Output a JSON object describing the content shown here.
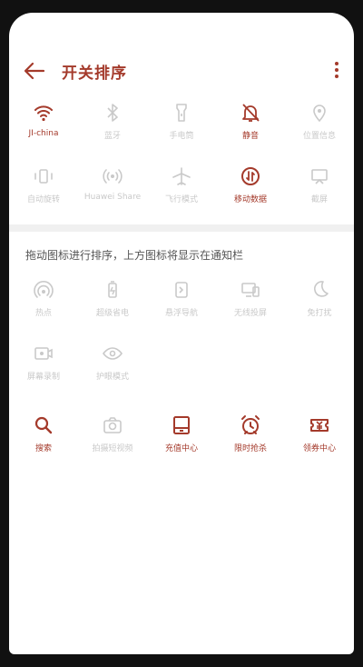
{
  "header": {
    "title": "开关排序"
  },
  "hint": "拖动图标进行排序，上方图标将显示在通知栏",
  "colors": {
    "accent": "#a43a2b",
    "inactive": "#c9c9c9"
  },
  "top_items": [
    {
      "label": "JI-china",
      "icon": "wifi-icon",
      "active": true
    },
    {
      "label": "蓝牙",
      "icon": "bluetooth-icon",
      "active": false
    },
    {
      "label": "手电筒",
      "icon": "flashlight-icon",
      "active": false
    },
    {
      "label": "静音",
      "icon": "bell-off-icon",
      "active": true
    },
    {
      "label": "位置信息",
      "icon": "location-icon",
      "active": false
    },
    {
      "label": "自动旋转",
      "icon": "rotate-icon",
      "active": false
    },
    {
      "label": "Huawei Share",
      "icon": "share-icon",
      "active": false
    },
    {
      "label": "飞行模式",
      "icon": "airplane-icon",
      "active": false
    },
    {
      "label": "移动数据",
      "icon": "mobile-data-icon",
      "active": true
    },
    {
      "label": "截屏",
      "icon": "screenshot-icon",
      "active": false
    }
  ],
  "bottom_items": [
    {
      "label": "热点",
      "icon": "hotspot-icon",
      "active": false
    },
    {
      "label": "超级省电",
      "icon": "battery-icon",
      "active": false
    },
    {
      "label": "悬浮导航",
      "icon": "float-nav-icon",
      "active": false
    },
    {
      "label": "无线投屏",
      "icon": "cast-icon",
      "active": false
    },
    {
      "label": "免打扰",
      "icon": "moon-icon",
      "active": false
    },
    {
      "label": "屏幕录制",
      "icon": "record-icon",
      "active": false
    },
    {
      "label": "护眼模式",
      "icon": "eye-icon",
      "active": false
    }
  ],
  "extra_items": [
    {
      "label": "搜索",
      "icon": "search-icon",
      "active": true
    },
    {
      "label": "拍摄短视频",
      "icon": "camera-icon",
      "active": false
    },
    {
      "label": "充值中心",
      "icon": "recharge-icon",
      "active": true
    },
    {
      "label": "限时抢杀",
      "icon": "alarm-clock-icon",
      "active": true
    },
    {
      "label": "领券中心",
      "icon": "coupon-icon",
      "active": true
    }
  ]
}
